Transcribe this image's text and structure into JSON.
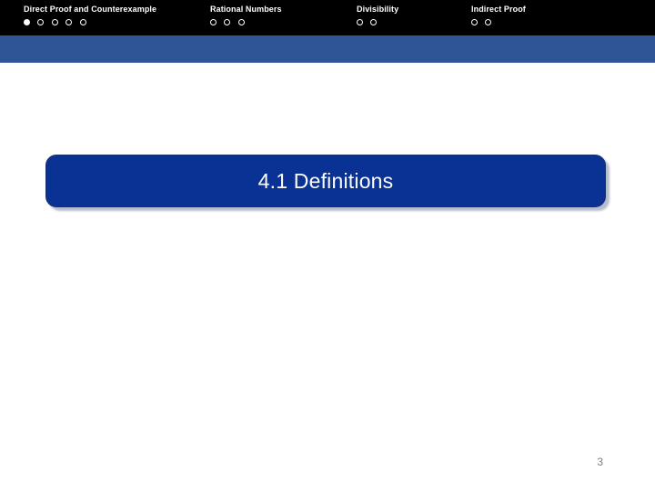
{
  "slide": {
    "title": "4.1 Definitions",
    "page_number": "3",
    "colors": {
      "header_background": "#000000",
      "accent_band": "#2f5596",
      "title_box": "#0a3194",
      "title_text": "#ffffff",
      "page_number": "#808080",
      "slide_background": "#ffffff"
    }
  },
  "nav": {
    "sections": [
      {
        "label": "Direct Proof and Counterexample",
        "dots": [
          "filled",
          "hollow",
          "hollow",
          "hollow",
          "hollow"
        ]
      },
      {
        "label": "Rational Numbers",
        "dots": [
          "hollow",
          "hollow",
          "hollow"
        ]
      },
      {
        "label": "Divisibility",
        "dots": [
          "hollow",
          "hollow"
        ]
      },
      {
        "label": "Indirect Proof",
        "dots": [
          "hollow",
          "hollow"
        ]
      }
    ]
  }
}
